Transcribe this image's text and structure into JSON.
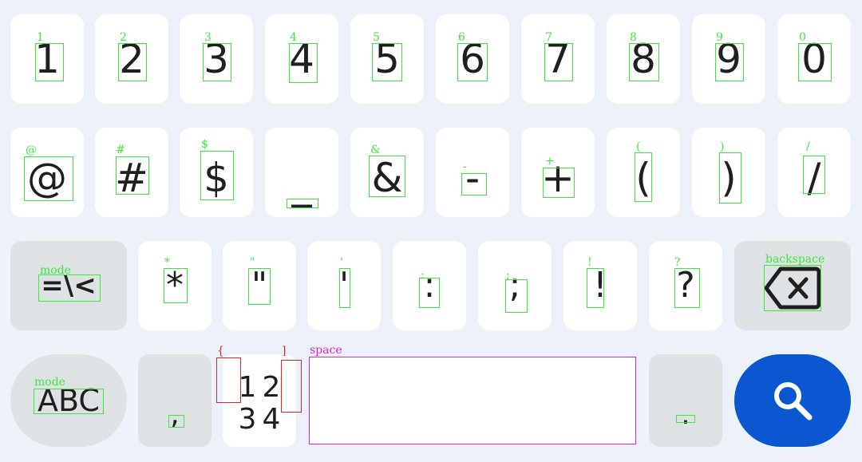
{
  "rows": {
    "digits": [
      {
        "label": "1",
        "name": "1"
      },
      {
        "label": "2",
        "name": "2"
      },
      {
        "label": "3",
        "name": "3"
      },
      {
        "label": "4",
        "name": "4"
      },
      {
        "label": "5",
        "name": "5"
      },
      {
        "label": "6",
        "name": "6"
      },
      {
        "label": "7",
        "name": "7"
      },
      {
        "label": "8",
        "name": "8"
      },
      {
        "label": "9",
        "name": "9"
      },
      {
        "label": "0",
        "name": "0"
      }
    ],
    "symbols1": [
      {
        "label": "@",
        "name": "@"
      },
      {
        "label": "#",
        "name": "#"
      },
      {
        "label": "$",
        "name": "$"
      },
      {
        "label": "_",
        "name": "_"
      },
      {
        "label": "&",
        "name": "&"
      },
      {
        "label": "-",
        "name": "-"
      },
      {
        "label": "+",
        "name": "+"
      },
      {
        "label": "(",
        "name": "("
      },
      {
        "label": ")",
        "name": ")"
      },
      {
        "label": "/",
        "name": "/"
      }
    ],
    "symbols2": {
      "mode": {
        "label": "=\\<",
        "name": "mode"
      },
      "keys": [
        {
          "label": "*",
          "name": "*"
        },
        {
          "label": "\"",
          "name": "\""
        },
        {
          "label": "'",
          "name": "'"
        },
        {
          "label": ":",
          "name": ":"
        },
        {
          "label": ";",
          "name": ";"
        },
        {
          "label": "!",
          "name": "!"
        },
        {
          "label": "?",
          "name": "?"
        }
      ],
      "backspace": {
        "name": "backspace"
      }
    },
    "bottom": {
      "mode": {
        "label": "ABC",
        "name": "mode"
      },
      "comma": {
        "label": ",",
        "name": ""
      },
      "numpad": {
        "digits": [
          "1",
          "2",
          "3",
          "4"
        ],
        "brace_open": "{",
        "brace_close": "]"
      },
      "space": {
        "name": "space"
      },
      "period": {
        "label": ".",
        "name": ""
      }
    }
  },
  "colors": {
    "background": "#edf2fa",
    "key": "#ffffff",
    "function_key": "#dfe2e4",
    "search_key": "#0b57d0",
    "annotation_green": "#3ce83c",
    "annotation_red": "#d9262c",
    "annotation_magenta": "#dd22dd"
  },
  "icons": {
    "backspace": "backspace-icon",
    "search": "search-icon"
  }
}
